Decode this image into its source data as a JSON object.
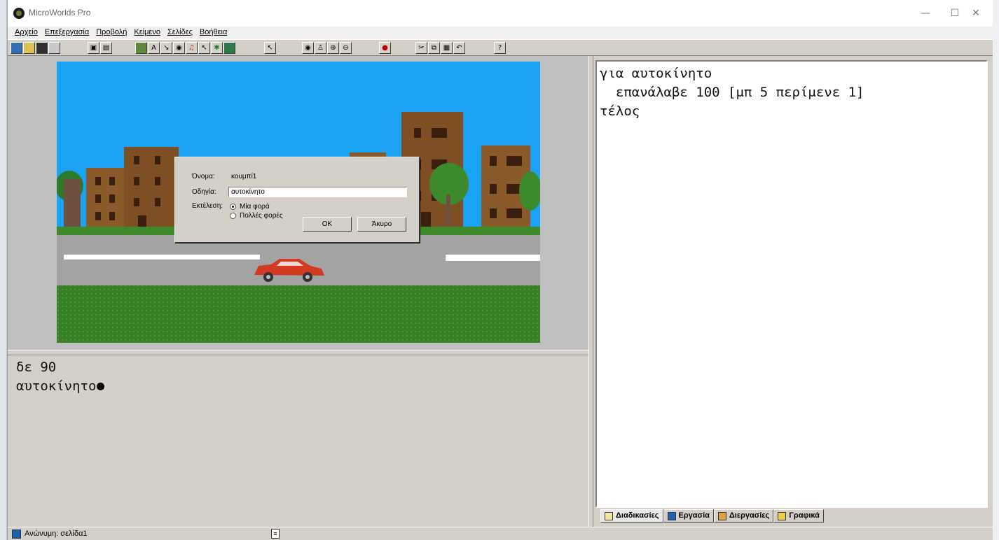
{
  "window": {
    "title": "MicroWorlds Pro",
    "minimize_glyph": "—",
    "maximize_glyph": "☐",
    "close_glyph": "✕"
  },
  "menu": [
    "Αρχείο",
    "Επεξεργασία",
    "Προβολή",
    "Κείμενο",
    "Σελίδες",
    "Βοήθεια"
  ],
  "toolbar": {
    "icons": [
      "new-page-icon",
      "open-icon",
      "save-icon",
      "print-icon",
      "page-icon",
      "page-list-icon",
      "turtle-icon",
      "text-box-icon",
      "button-icon",
      "eye-icon",
      "music-icon",
      "slider-icon",
      "shapes-icon",
      "turtle-shape-icon",
      "pointer-icon",
      "eye2-icon",
      "stamp-icon",
      "zoom-in-icon",
      "zoom-out-icon",
      "stop-icon",
      "cut-icon",
      "copy-icon",
      "paste-icon",
      "undo-icon",
      "help-icon"
    ]
  },
  "dialog": {
    "name_label": "Όνομα:",
    "name_value": "κουμπί1",
    "instruction_label": "Οδηγία:",
    "instruction_value": "αυτοκίνητο",
    "run_label": "Εκτέλεση:",
    "option_once": "Μία φορά",
    "option_many": "Πολλές φορές",
    "selected": "once",
    "ok_label": "OK",
    "cancel_label": "Άκυρο"
  },
  "command_center": {
    "lines": [
      "δε 90",
      "αυτοκίνητο"
    ]
  },
  "procedures": {
    "lines": [
      "για αυτοκίνητο",
      "  επανάλαβε 100 [μπ 5 περίμενε 1]",
      "τέλος"
    ]
  },
  "tabs": [
    "Διαδικασίες",
    "Εργασία",
    "Διεργασίες",
    "Γραφικά"
  ],
  "statusbar": {
    "page": "Ανώνυμη: σελίδα1"
  },
  "colors": {
    "sky": "#1aa3f3",
    "road": "#a3a3a3",
    "grass": "#3e8a2a",
    "brick": "#8b5a2b",
    "car": "#d23a22"
  }
}
